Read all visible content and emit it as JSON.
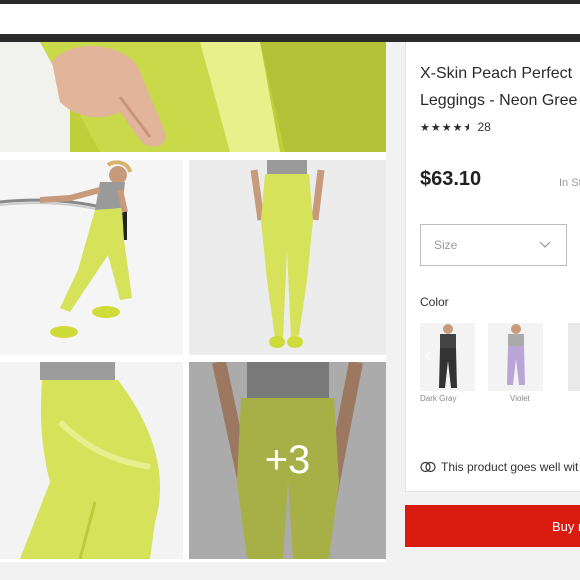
{
  "product": {
    "title_line1": "X-Skin Peach Perfect",
    "title_line2": "Leggings - Neon Gree",
    "rating_stars": 4.5,
    "review_count": "28",
    "price": "$63.10",
    "stock": "In St"
  },
  "size_select": {
    "placeholder": "Size"
  },
  "colors": {
    "label": "Color",
    "options": [
      {
        "name": "Dark Gray",
        "hex": "#333333"
      },
      {
        "name": "Violet",
        "hex": "#b9a6d6"
      },
      {
        "name": "",
        "hex": "#e9e9e9"
      }
    ]
  },
  "gallery": {
    "more_count": "+3",
    "product_color": "#d6e25a"
  },
  "goes_well": {
    "text": "This product goes well wit"
  },
  "buy_button": {
    "label": "Buy n"
  }
}
